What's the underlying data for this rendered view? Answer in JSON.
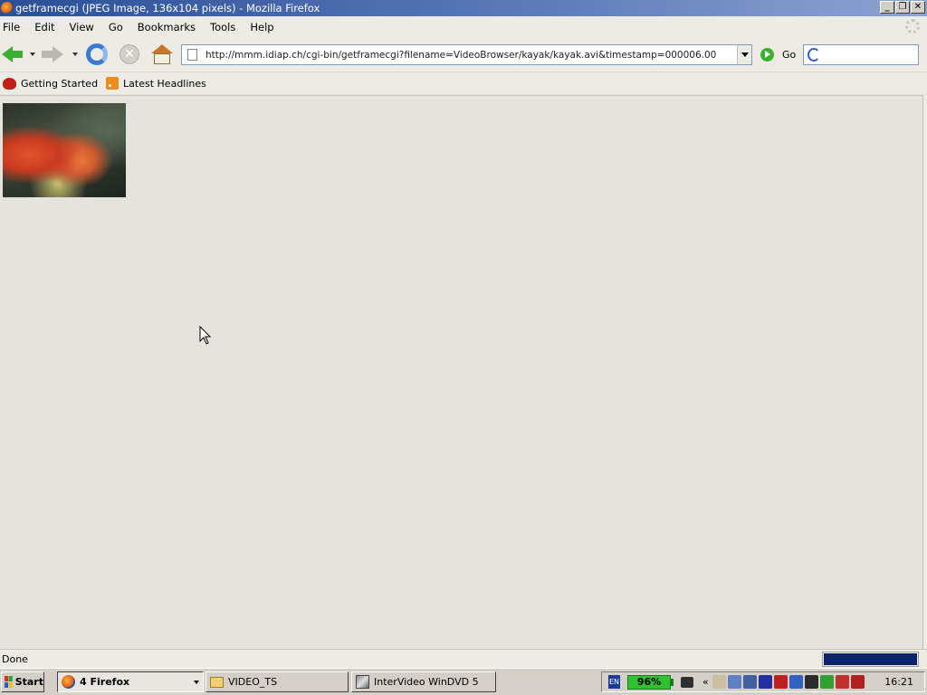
{
  "window": {
    "title": "getframecgi (JPEG Image, 136x104 pixels) - Mozilla Firefox",
    "buttons": [
      "_",
      "❐",
      "✕"
    ]
  },
  "menu": {
    "items": [
      {
        "label": "File"
      },
      {
        "label": "Edit"
      },
      {
        "label": "View"
      },
      {
        "label": "Go"
      },
      {
        "label": "Bookmarks"
      },
      {
        "label": "Tools"
      },
      {
        "label": "Help"
      }
    ]
  },
  "navigation": {
    "url": "http://mmm.idiap.ch/cgi-bin/getframecgi?filename=VideoBrowser/kayak/kayak.avi&timestamp=000006.00",
    "go_label": "Go",
    "search_value": ""
  },
  "bookmarks": {
    "items": [
      {
        "label": "Getting Started",
        "icon": "firefox-bookmark-icon"
      },
      {
        "label": "Latest Headlines",
        "icon": "rss-feed-icon"
      }
    ]
  },
  "content": {
    "image_alt": "kayak video frame"
  },
  "status": {
    "text": "Done"
  },
  "taskbar": {
    "start_label": "Start",
    "tasks": [
      {
        "label": "4 Firefox",
        "icon": "firefox-icon",
        "active": true
      },
      {
        "label": "VIDEO_TS",
        "icon": "folder-icon",
        "active": false
      },
      {
        "label": "InterVideo WinDVD 5",
        "icon": "windvd-icon",
        "active": false
      }
    ],
    "tray": {
      "language": "EN",
      "battery": "96%",
      "chevron": "«",
      "clock": "16:21",
      "icon_colors": [
        "#c8c0a0",
        "#6080c0",
        "#4060a0",
        "#2030a0",
        "#c02020",
        "#3060c0",
        "#2a2a2a",
        "#30a030",
        "#c03030",
        "#b02020"
      ]
    }
  },
  "colors": {
    "titlebar_start": "#2a4f98",
    "content_bg": "#e4e4dc",
    "progress": "#0a246a"
  }
}
